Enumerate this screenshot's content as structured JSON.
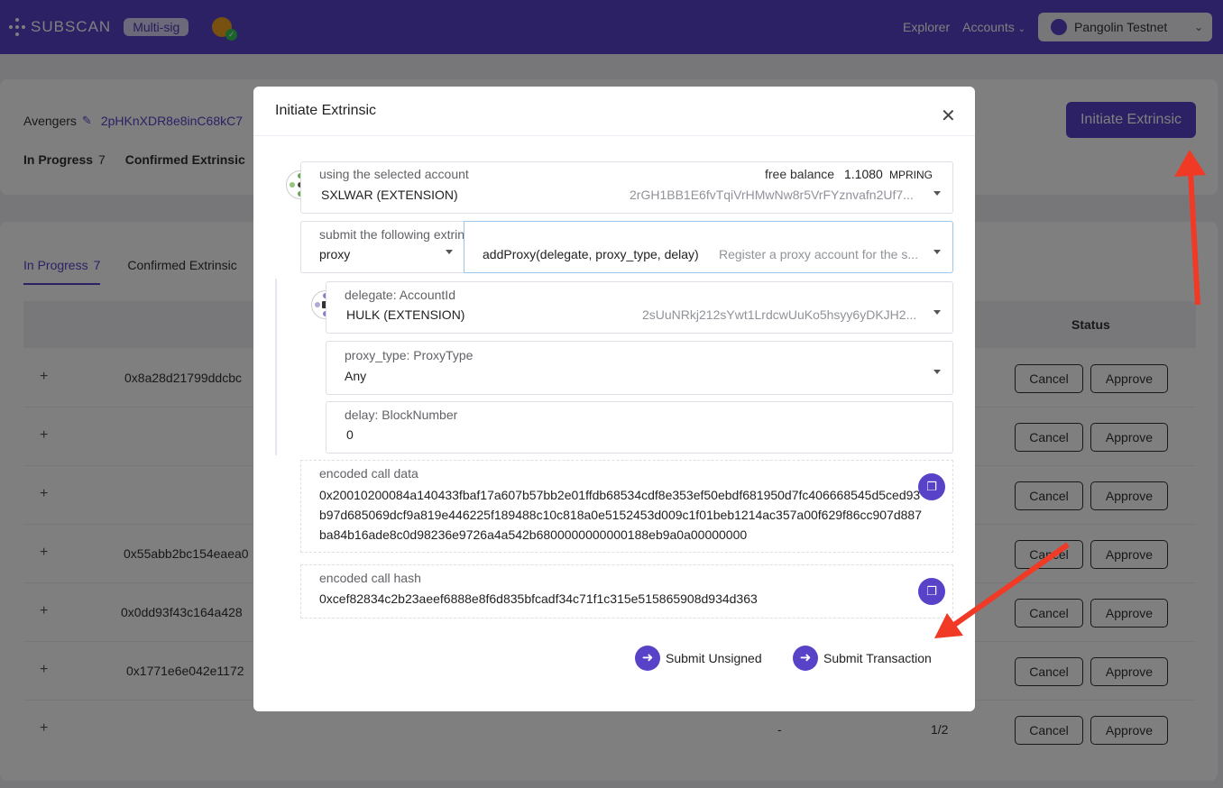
{
  "nav": {
    "brand": "SUBSCAN",
    "badge": "Multi-sig",
    "links": [
      "Explorer",
      "Accounts"
    ],
    "network": "Pangolin Testnet"
  },
  "account": {
    "name": "Avengers",
    "address": "2pHKnXDR8e8inC68kC7",
    "stats": {
      "in_progress_label": "In Progress",
      "in_progress_count": "7",
      "confirmed_label": "Confirmed Extrinsic"
    },
    "initiate_button": "Initiate Extrinsic"
  },
  "list": {
    "tabs": [
      {
        "label": "In Progress",
        "count": "7"
      },
      {
        "label": "Confirmed Extrinsic"
      }
    ],
    "status_header": "Status",
    "rows": [
      {
        "hash": "0x8a28d21799ddcbc",
        "dash": "",
        "frac": ""
      },
      {
        "hash": "",
        "dash": "",
        "frac": ""
      },
      {
        "hash": "",
        "dash": "",
        "frac": ""
      },
      {
        "hash": "0x55abb2bc154eaea0",
        "dash": "",
        "frac": ""
      },
      {
        "hash": "0x0dd93f43c164a428",
        "dash": "",
        "frac": ""
      },
      {
        "hash": "0x1771e6e042e1172",
        "dash": "",
        "frac": ""
      },
      {
        "hash": "",
        "dash": "-",
        "frac": "1/2"
      }
    ],
    "cancel_label": "Cancel",
    "approve_label": "Approve"
  },
  "modal": {
    "title": "Initiate Extrinsic",
    "account": {
      "label": "using the selected account",
      "name": "SXLWAR (EXTENSION)",
      "balance_label": "free balance",
      "balance_value": "1.1080",
      "balance_unit": "MPRING",
      "address": "2rGH1BB1E6fvTqiVrHMwNw8r5VrFYznvafn2Uf7..."
    },
    "extrinsic": {
      "label": "submit the following extrinsic",
      "module": "proxy",
      "call": "addProxy(delegate, proxy_type, delay)",
      "description": "Register a proxy account for the s..."
    },
    "params": [
      {
        "label": "delegate: AccountId",
        "value": "HULK (EXTENSION)",
        "address": "2sUuNRkj212sYwt1LrdcwUuKo5hsyy6yDKJH2..."
      },
      {
        "label": "proxy_type: ProxyType",
        "value": "Any"
      },
      {
        "label": "delay: BlockNumber",
        "value": "0"
      }
    ],
    "call_data": {
      "label": "encoded call data",
      "value": "0x20010200084a140433fbaf17a607b57bb2e01ffdb68534cdf8e353ef50ebdf681950d7fc406668545d5ced93b97d685069dcf9a819e446225f189488c10c818a0e5152453d009c1f01beb1214ac357a00f629f86cc907d887ba84b16ade8c0d98236e9726a4a542b6800000000000188eb9a0a00000000"
    },
    "call_hash": {
      "label": "encoded call hash",
      "value": "0xcef82834c2b23aeef6888e8f6d835bfcadf34c71f1c315e515865908d934d363"
    },
    "submit_unsigned": "Submit Unsigned",
    "submit_transaction": "Submit Transaction"
  },
  "colors": {
    "accent": "#5742c8",
    "annotation_arrow": "#f03a26"
  }
}
